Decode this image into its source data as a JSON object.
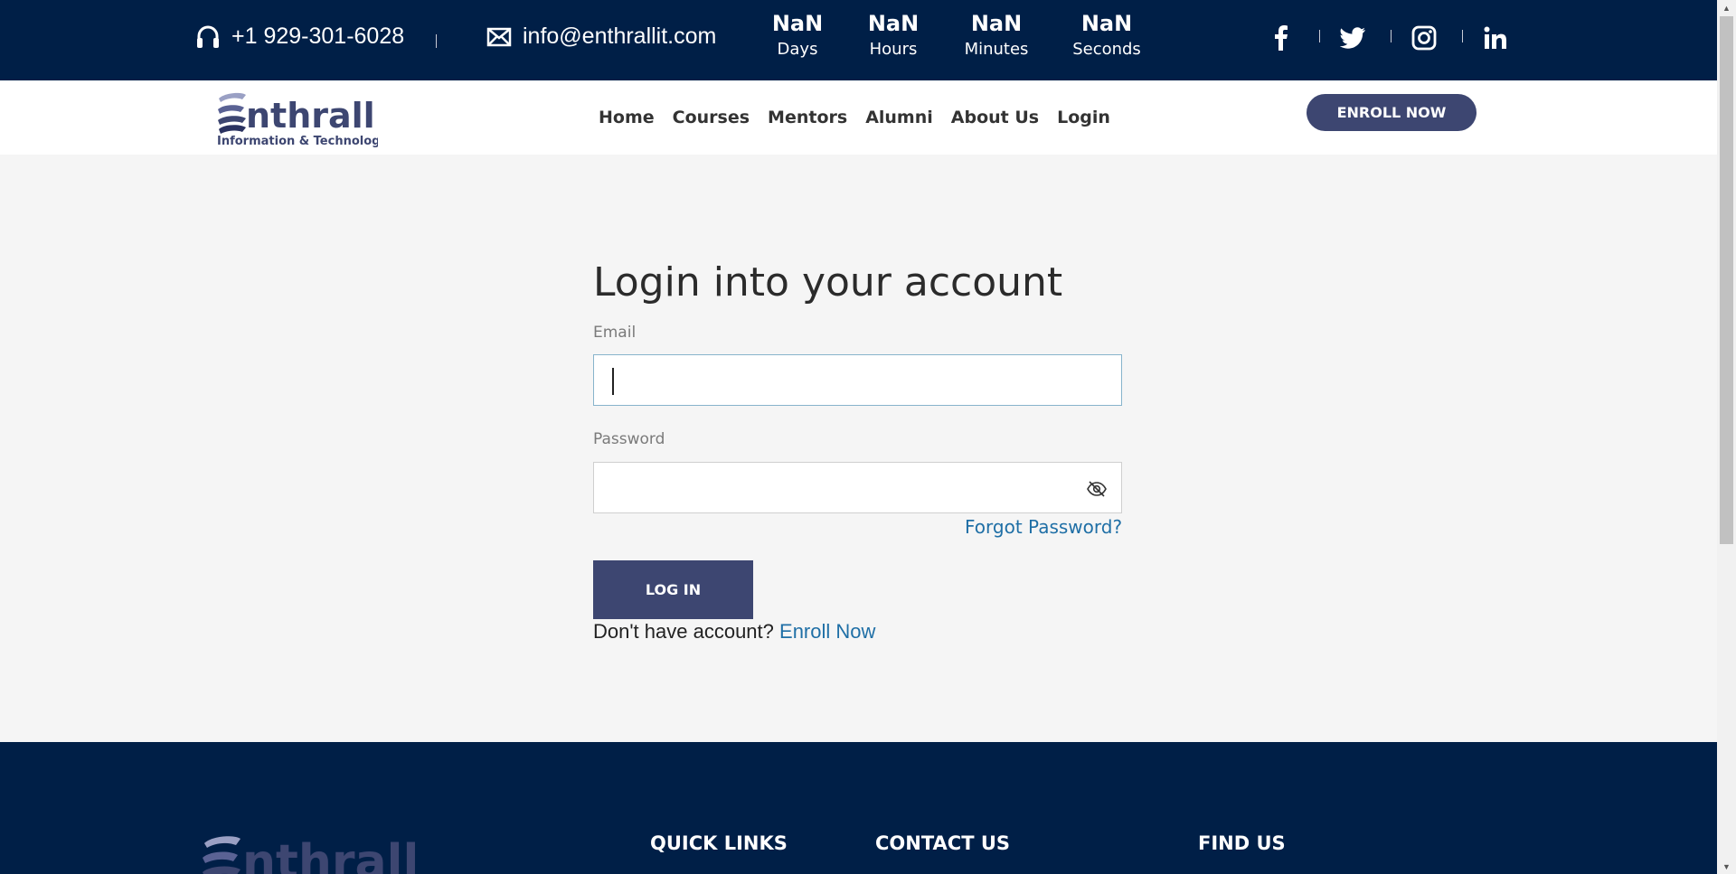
{
  "topbar": {
    "phone": "+1 929-301-6028",
    "email": "info@enthrallit.com",
    "countdown": [
      {
        "value": "NaN",
        "label": "Days"
      },
      {
        "value": "NaN",
        "label": "Hours"
      },
      {
        "value": "NaN",
        "label": "Minutes"
      },
      {
        "value": "NaN",
        "label": "Seconds"
      }
    ],
    "social_icons": [
      "facebook-icon",
      "twitter-icon",
      "instagram-icon",
      "linkedin-icon"
    ]
  },
  "brand": {
    "name": "nthrall",
    "tagline": "Information & Technology",
    "color": "#3d4671"
  },
  "nav": {
    "items": [
      "Home",
      "Courses",
      "Mentors",
      "Alumni",
      "About Us",
      "Login"
    ],
    "enroll_label": "ENROLL NOW"
  },
  "login": {
    "title": "Login into your account",
    "email_label": "Email",
    "email_value": "",
    "password_label": "Password",
    "password_value": "",
    "forgot_label": "Forgot Password?",
    "submit_label": "LOG IN",
    "signup_prompt": "Don't have account?",
    "signup_link": "Enroll Now"
  },
  "footer": {
    "brand_name": "nthrall",
    "quick_links_heading": "QUICK LINKS",
    "contact_heading": "CONTACT US",
    "find_heading": "FIND US"
  },
  "colors": {
    "topbar_bg": "#001f47",
    "accent": "#3d4671",
    "link": "#1f6fa6",
    "page_bg": "#f5f5f5"
  }
}
